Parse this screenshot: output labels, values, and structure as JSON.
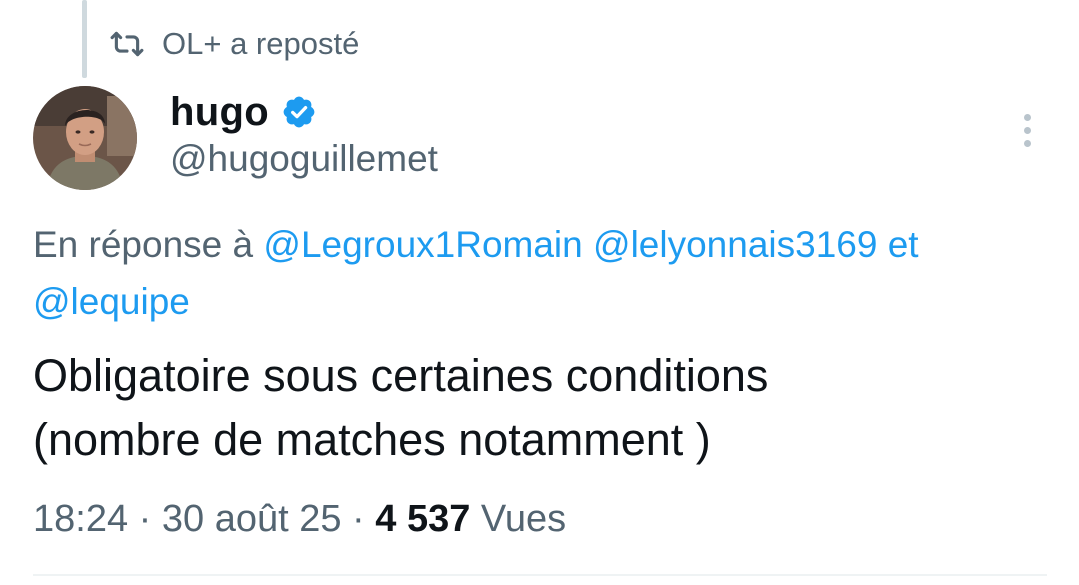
{
  "repost": {
    "icon": "repost-icon",
    "text": "OL+ a reposté"
  },
  "author": {
    "display_name": "hugo",
    "verified_icon": "verified-badge-icon",
    "handle": "@hugoguillemet",
    "avatar_icon": "avatar-photo"
  },
  "menu": {
    "icon": "more-vertical-icon"
  },
  "reply": {
    "prefix": "En réponse à",
    "mention_1": "@Legroux1Romain",
    "mention_2": "@lelyonnais3169",
    "conjunction": "et",
    "mention_3": "@lequipe"
  },
  "tweet": {
    "line_1": "Obligatoire sous certaines conditions",
    "line_2": "(nombre de matches notamment )"
  },
  "meta": {
    "time": "18:24",
    "date": "30 août 25",
    "views_count": "4 537",
    "views_label": "Vues"
  },
  "colors": {
    "accent": "#1d9bf0",
    "secondary_text": "#536471",
    "primary_text": "#0f1419"
  }
}
